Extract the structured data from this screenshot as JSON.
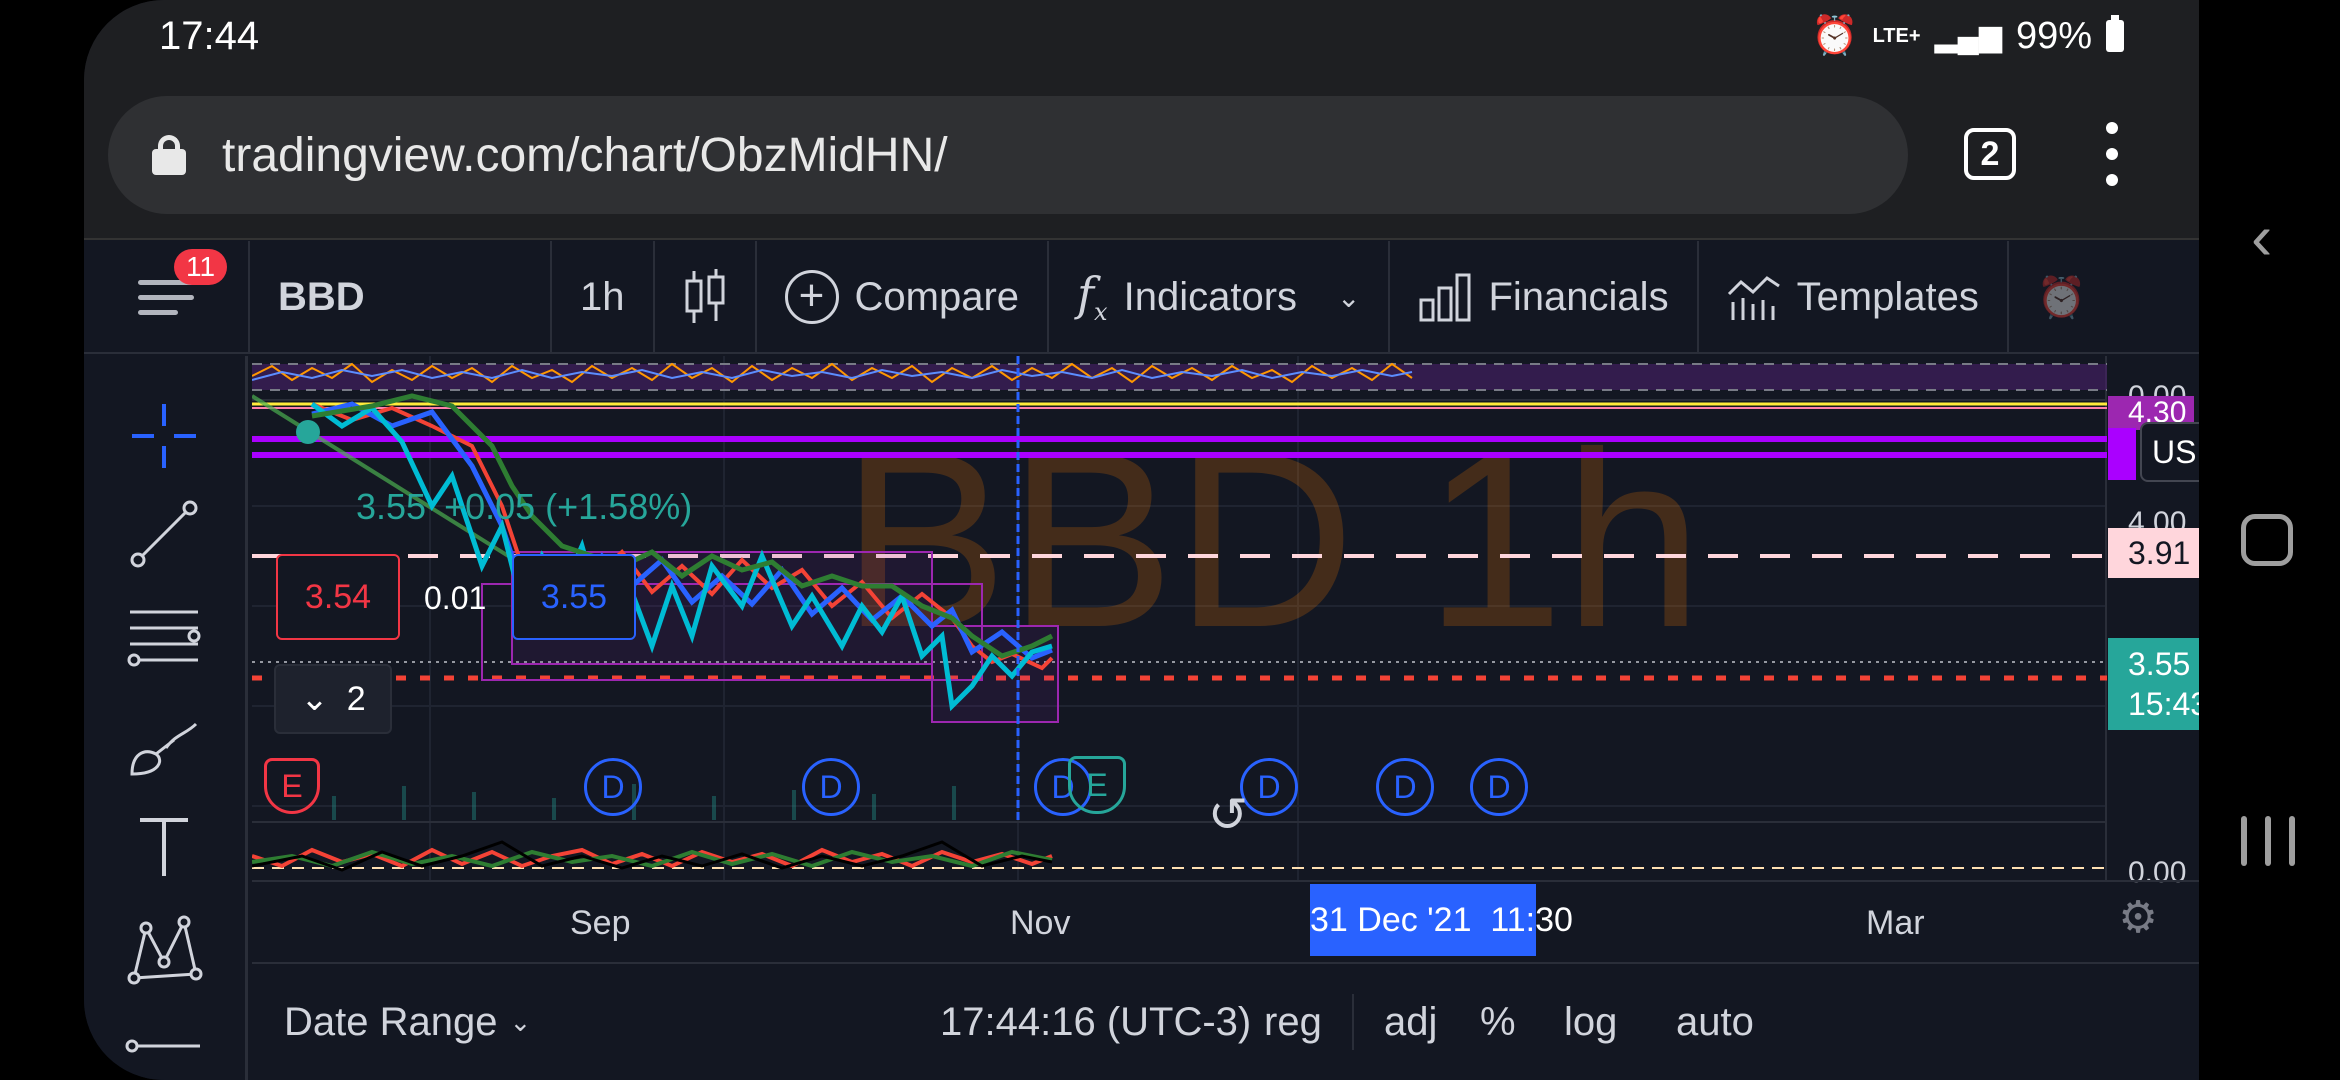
{
  "status_bar": {
    "time": "17:44",
    "network": "LTE+",
    "battery": "99%"
  },
  "browser": {
    "url": "tradingview.com/chart/ObzMidHN/",
    "tab_count": "2"
  },
  "toolbar": {
    "notification_count": "11",
    "symbol": "BBD",
    "interval": "1h",
    "compare": "Compare",
    "indicators": "Indicators",
    "financials": "Financials",
    "templates": "Templates"
  },
  "legend": {
    "price": "3.55",
    "change": "+0.05 (+1.58%)",
    "sell_price": "3.54",
    "spread": "0.01",
    "buy_price": "3.55",
    "collapsed_count": "2"
  },
  "watermark": {
    "text": "BBD 1h"
  },
  "price_axis": {
    "currency": "USD",
    "labels": [
      "0.00",
      "4.30",
      "4.00",
      "0.00"
    ],
    "alert_price": "3.91",
    "current_price": "3.55",
    "countdown": "15:43"
  },
  "event_markers": [
    "E",
    "D",
    "D",
    "D",
    "E",
    "D",
    "D",
    "D"
  ],
  "time_axis": {
    "labels": [
      "Sep",
      "Nov",
      "Mar"
    ],
    "crosshair_label": "31 Dec '21  11:30"
  },
  "bottom_bar": {
    "date_range": "Date Range",
    "clock": "17:44:16 (UTC-3)",
    "session": "reg",
    "adj": "adj",
    "percent": "%",
    "log": "log",
    "auto": "auto"
  },
  "colors": {
    "background": "#131722",
    "accent_blue": "#2962ff",
    "up_teal": "#26a69a",
    "down_red": "#f23645",
    "alert_pink": "#ffd6dc",
    "purple": "#aa00ff"
  }
}
